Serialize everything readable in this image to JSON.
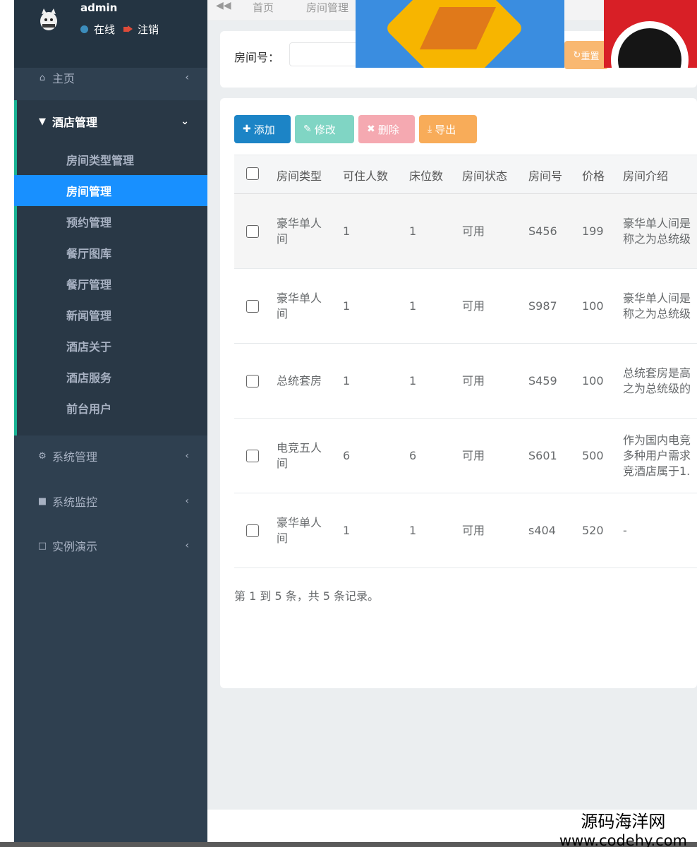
{
  "profile": {
    "name": "admin",
    "status_online": "在线",
    "logout": "注销"
  },
  "sidebar": {
    "items": [
      {
        "label": "主页",
        "icon": "home-icon"
      },
      {
        "label": "酒店管理",
        "icon": "filter-icon"
      },
      {
        "label": "系统管理",
        "icon": "gear-icon"
      },
      {
        "label": "系统监控",
        "icon": "video-icon"
      },
      {
        "label": "实例演示",
        "icon": "monitor-icon"
      }
    ],
    "sub_items": [
      "房间类型管理",
      "房间管理",
      "预约管理",
      "餐厅图库",
      "餐厅管理",
      "新闻管理",
      "酒店关于",
      "酒店服务",
      "前台用户"
    ],
    "active_sub": "房间管理"
  },
  "tabs": {
    "home": "首页",
    "current": "房间管理"
  },
  "search": {
    "label": "房间号：",
    "reset": "重置"
  },
  "toolbar": {
    "add": "添加",
    "edit": "修改",
    "delete": "删除",
    "export": "导出"
  },
  "table": {
    "headers": [
      "房间类型",
      "可住人数",
      "床位数",
      "房间状态",
      "房间号",
      "价格",
      "房间介绍"
    ],
    "rows": [
      {
        "type_l1": "豪华单人",
        "type_l2": "间",
        "capacity": "1",
        "beds": "1",
        "status": "可用",
        "room_no": "S456",
        "price": "199",
        "intro_l1": "豪华单人间是",
        "intro_l2": "称之为总统级",
        "intro_l3": ""
      },
      {
        "type_l1": "豪华单人",
        "type_l2": "间",
        "capacity": "1",
        "beds": "1",
        "status": "可用",
        "room_no": "S987",
        "price": "100",
        "intro_l1": "豪华单人间是",
        "intro_l2": "称之为总统级",
        "intro_l3": ""
      },
      {
        "type_l1": "总统套房",
        "type_l2": "",
        "capacity": "1",
        "beds": "1",
        "status": "可用",
        "room_no": "S459",
        "price": "100",
        "intro_l1": "总统套房是高",
        "intro_l2": "之为总统级的",
        "intro_l3": ""
      },
      {
        "type_l1": "电竞五人",
        "type_l2": "间",
        "capacity": "6",
        "beds": "6",
        "status": "可用",
        "room_no": "S601",
        "price": "500",
        "intro_l1": "作为国内电竞",
        "intro_l2": "多种用户需求",
        "intro_l3": "竞酒店属于1."
      },
      {
        "type_l1": "豪华单人",
        "type_l2": "间",
        "capacity": "1",
        "beds": "1",
        "status": "可用",
        "room_no": "s404",
        "price": "520",
        "intro_l1": "-",
        "intro_l2": "",
        "intro_l3": ""
      }
    ]
  },
  "pager": {
    "text": "第 1 到 5 条，共 5 条记录。"
  },
  "watermark": {
    "line1": "源码海洋网",
    "line2": "www.codehy.com"
  },
  "colors": {
    "sidebar": "#2f4050",
    "active": "#1890ff",
    "add": "#1c84c6",
    "edit": "#1ab394",
    "delete": "#ed5565",
    "export": "#f8ac59"
  }
}
